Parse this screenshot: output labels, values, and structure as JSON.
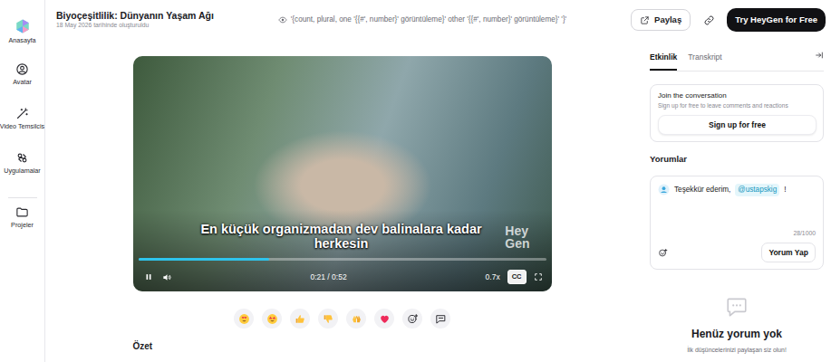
{
  "sidebar": {
    "items": [
      {
        "label": "Anasayfa",
        "selected": false
      },
      {
        "label": "Avatar",
        "selected": false
      },
      {
        "label": "Video Temsilcis",
        "selected": false
      },
      {
        "label": "Uygulamalar",
        "selected": false
      },
      {
        "label": "Projeler",
        "selected": false
      }
    ]
  },
  "header": {
    "title": "Biyoçeşitlilik: Dünyanın Yaşam Ağı",
    "subtitle": "18 May 2026 tarihinde oluşturuldu",
    "views": "'{count, plural, one '{{#', number}' görüntüleme}' other '{{#', number}' görüntüleme}' '}'",
    "share": "Paylaş",
    "cta": "Try HeyGen for Free"
  },
  "player": {
    "caption": "En küçük organizmadan dev balinalara kadar herkesin",
    "watermark": [
      "Hey",
      "Gen"
    ],
    "playing": true,
    "progress": 0.32,
    "time": "0:21 / 0:52",
    "speed": "0.7x",
    "cc": "CC",
    "cc_on": true
  },
  "reactions": [
    {
      "kind": "love"
    },
    {
      "kind": "starstruck"
    },
    {
      "kind": "thumbsup"
    },
    {
      "kind": "thumbsdown"
    },
    {
      "kind": "hands"
    },
    {
      "kind": "heart"
    },
    {
      "kind": "addemoji"
    },
    {
      "kind": "comment"
    }
  ],
  "summary": {
    "title": "Özet"
  },
  "panel": {
    "tabs": [
      {
        "label": "Etkinlik",
        "selected": true
      },
      {
        "label": "Transkript",
        "selected": false
      }
    ],
    "join": {
      "title": "Join the conversation",
      "text": "Sign up for free to leave comments and reactions",
      "button": "Sign up for free"
    },
    "comments_title": "Yorumlar",
    "draft": {
      "text": "Teşekkür ederim,",
      "mention": "@ustapskig",
      "suffix": "!",
      "counter": "28/1000",
      "submit": "Yorum Yap"
    },
    "empty": {
      "title": "Henüz yorum yok",
      "text": "İlk düşüncelerinizi paylaşan siz olun!"
    }
  }
}
